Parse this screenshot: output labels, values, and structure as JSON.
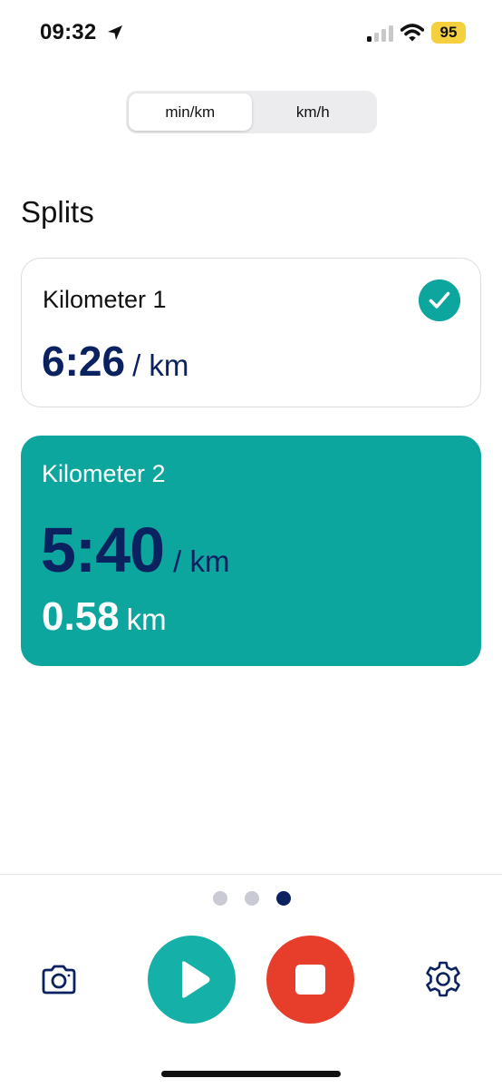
{
  "status_bar": {
    "time": "09:32",
    "battery": "95",
    "icons": [
      "location-arrow-icon",
      "cellular-signal-icon",
      "wifi-icon",
      "battery-icon"
    ]
  },
  "unit_toggle": {
    "options": [
      "min/km",
      "km/h"
    ],
    "selected": "min/km"
  },
  "section_title": "Splits",
  "splits": [
    {
      "label": "Kilometer 1",
      "pace": "6:26",
      "unit": "/ km",
      "completed": true
    },
    {
      "label": "Kilometer 2",
      "pace": "5:40",
      "unit": "/ km",
      "distance": "0.58",
      "distance_unit": "km",
      "active": true
    }
  ],
  "pager": {
    "pages": 3,
    "current_page": 3
  },
  "controls": {
    "icons": [
      "camera-icon",
      "play-icon",
      "stop-icon",
      "settings-gear-icon"
    ]
  },
  "colors": {
    "accent_teal": "#0ca69e",
    "navy": "#0b2260",
    "stop_red": "#e63e2a",
    "battery_yellow": "#f4d03f"
  }
}
